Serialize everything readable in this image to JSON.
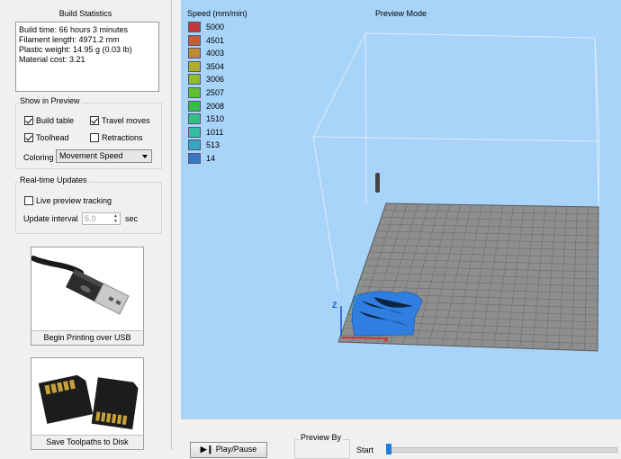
{
  "build_statistics": {
    "title": "Build Statistics",
    "lines": [
      "Build time: 66 hours 3 minutes",
      "Filament length: 4971.2 mm",
      "Plastic weight: 14.95 g (0.03 lb)",
      "Material cost: 3.21"
    ]
  },
  "show_in_preview": {
    "label": "Show in Preview",
    "build_table": {
      "label": "Build table",
      "checked": true
    },
    "travel_moves": {
      "label": "Travel moves",
      "checked": true
    },
    "toolhead": {
      "label": "Toolhead",
      "checked": true
    },
    "retractions": {
      "label": "Retractions",
      "checked": false
    },
    "coloring_label": "Coloring",
    "coloring_value": "Movement Speed"
  },
  "realtime_updates": {
    "label": "Real-time Updates",
    "live_tracking": {
      "label": "Live preview tracking",
      "checked": false
    },
    "interval_label": "Update interval",
    "interval_value": "5.0",
    "interval_unit": "sec"
  },
  "usb_button": {
    "label": "Begin Printing over USB",
    "icon": "usb-cable-icon"
  },
  "sd_button": {
    "label": "Save Toolpaths to Disk",
    "icon": "sd-card-icon"
  },
  "preview": {
    "mode_label": "Preview Mode",
    "legend_title": "Speed (mm/min)",
    "legend": [
      {
        "value": "5000",
        "color": "#c13a3a"
      },
      {
        "value": "4501",
        "color": "#c45f35"
      },
      {
        "value": "4003",
        "color": "#c08a32"
      },
      {
        "value": "3504",
        "color": "#b2ad2e"
      },
      {
        "value": "3006",
        "color": "#8fbd2c"
      },
      {
        "value": "2507",
        "color": "#5fc02f"
      },
      {
        "value": "2008",
        "color": "#34bf48"
      },
      {
        "value": "1510",
        "color": "#2ec27a"
      },
      {
        "value": "1011",
        "color": "#2fbfa5"
      },
      {
        "value": "513",
        "color": "#33a6c4"
      },
      {
        "value": "14",
        "color": "#3679c4"
      }
    ],
    "axis_z_label": "Z",
    "model_color": "#2f7ee0",
    "background_color": "#a8d4f9"
  },
  "controls": {
    "play_pause_label": "Play/Pause",
    "preview_by_label": "Preview By",
    "start_label": "Start"
  }
}
